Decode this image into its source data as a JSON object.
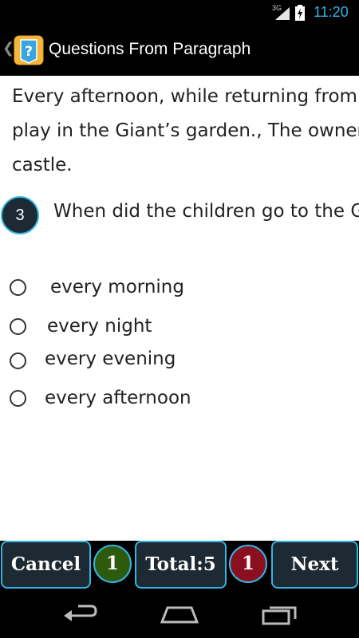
{
  "status_bar": {
    "network": "3G",
    "time": "11:20"
  },
  "action_bar": {
    "title": "Questions From Paragraph",
    "app_icon": "question-mark-icon"
  },
  "paragraph": {
    "lines": [
      "Every afternoon, while returning from school, the children used to go and",
      "play in the Giant’s garden., The owner of the garden was a Giant who lived in a",
      "castle."
    ]
  },
  "question": {
    "number": "3",
    "text": "When did the children go to the Giant’s garden?"
  },
  "options": [
    {
      "label": "every morning",
      "selected": false
    },
    {
      "label": "every night",
      "selected": false
    },
    {
      "label": "every evening",
      "selected": false
    },
    {
      "label": "every afternoon",
      "selected": false
    }
  ],
  "bottom_bar": {
    "cancel_label": "Cancel",
    "correct_count": "1",
    "total_label": "Total:5",
    "wrong_count": "1",
    "next_label": "Next",
    "colors": {
      "correct": "#2e5a0e",
      "wrong": "#8a1020",
      "button_bg": "#1d2a33",
      "accent": "#33b5e5"
    }
  },
  "nav_bar": {
    "icons": [
      "back-icon",
      "home-icon",
      "recent-apps-icon"
    ]
  }
}
